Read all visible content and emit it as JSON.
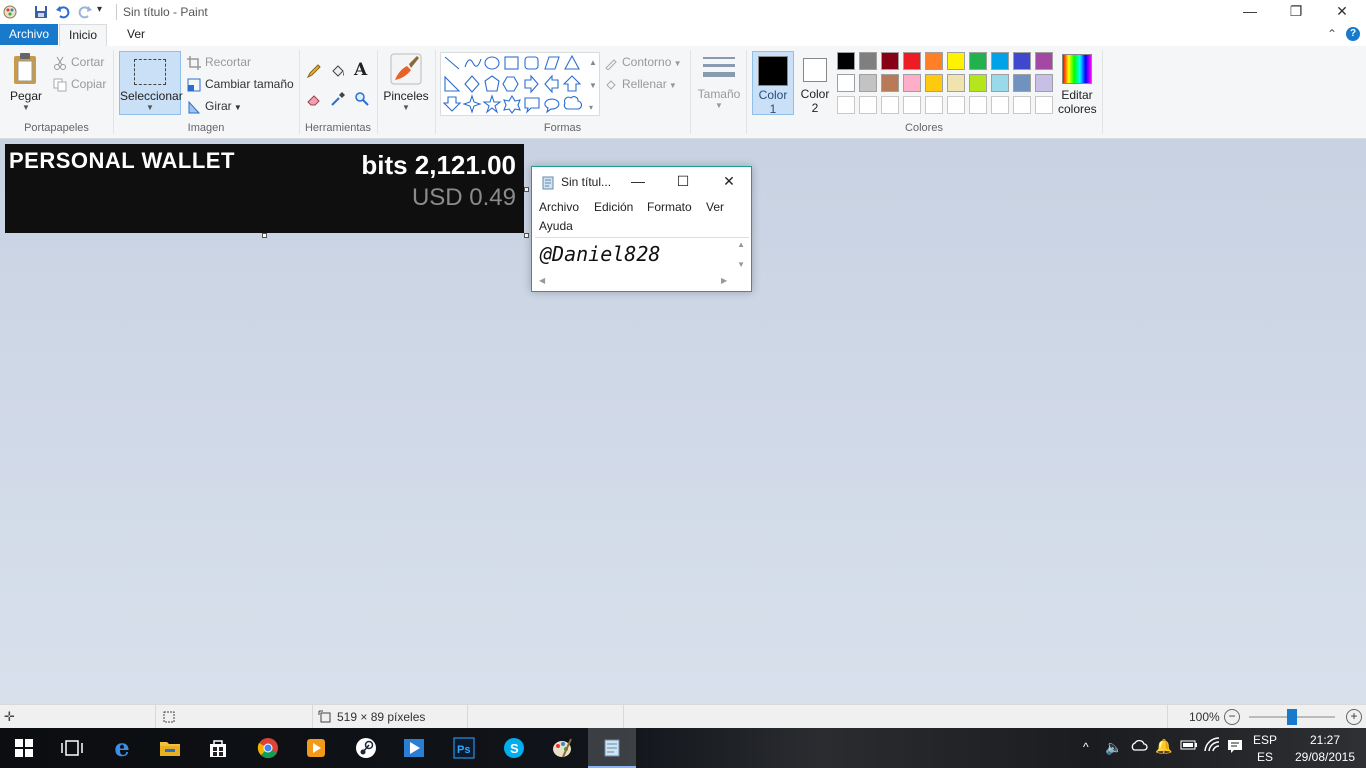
{
  "window": {
    "title": "Sin título - Paint",
    "minimize_glyph": "—",
    "restore_glyph": "❐",
    "close_glyph": "✕"
  },
  "tabs": [
    "Archivo",
    "Inicio",
    "Ver"
  ],
  "ribbon": {
    "clipboard": {
      "paste": "Pegar",
      "cut": "Cortar",
      "copy": "Copiar",
      "group_label": "Portapapeles"
    },
    "image": {
      "select": "Seleccionar",
      "crop": "Recortar",
      "resize": "Cambiar tamaño",
      "rotate": "Girar",
      "group_label": "Imagen"
    },
    "tools": {
      "group_label": "Herramientas"
    },
    "brushes": {
      "label": "Pinceles"
    },
    "shapes": {
      "outline": "Contorno",
      "fill": "Rellenar",
      "group_label": "Formas"
    },
    "size": {
      "label": "Tamaño"
    },
    "colors": {
      "color1_label": "Color",
      "color1_num": "1",
      "color2_label": "Color",
      "color2_num": "2",
      "edit_label_1": "Editar",
      "edit_label_2": "colores",
      "group_label": "Colores",
      "color1_value": "#000000",
      "color2_value": "#ffffff",
      "palette_row1": [
        "#000000",
        "#7f7f7f",
        "#880015",
        "#ed1c24",
        "#ff7f27",
        "#fff200",
        "#22b14c",
        "#00a2e8",
        "#3f48cc",
        "#a349a4"
      ],
      "palette_row2": [
        "#ffffff",
        "#c3c3c3",
        "#b97a57",
        "#ffaec9",
        "#ffc90e",
        "#efe4b0",
        "#b5e61d",
        "#99d9ea",
        "#7092be",
        "#c8bfe7"
      ]
    }
  },
  "canvas": {
    "wallet_title": "PERSONAL WALLET",
    "bits": "bits 2,121.00",
    "usd": "USD 0.49"
  },
  "notepad": {
    "title": "Sin títul...",
    "menu": [
      "Archivo",
      "Edición",
      "Formato",
      "Ver",
      "Ayuda"
    ],
    "content": "@Daniel828"
  },
  "statusbar": {
    "dimensions": "519 × 89 píxeles",
    "zoom": "100%",
    "zoom_level": 0.5
  },
  "taskbar": {
    "lang_code": "ESP",
    "lang_layout": "ES",
    "time": "21:27",
    "date": "29/08/2015"
  }
}
